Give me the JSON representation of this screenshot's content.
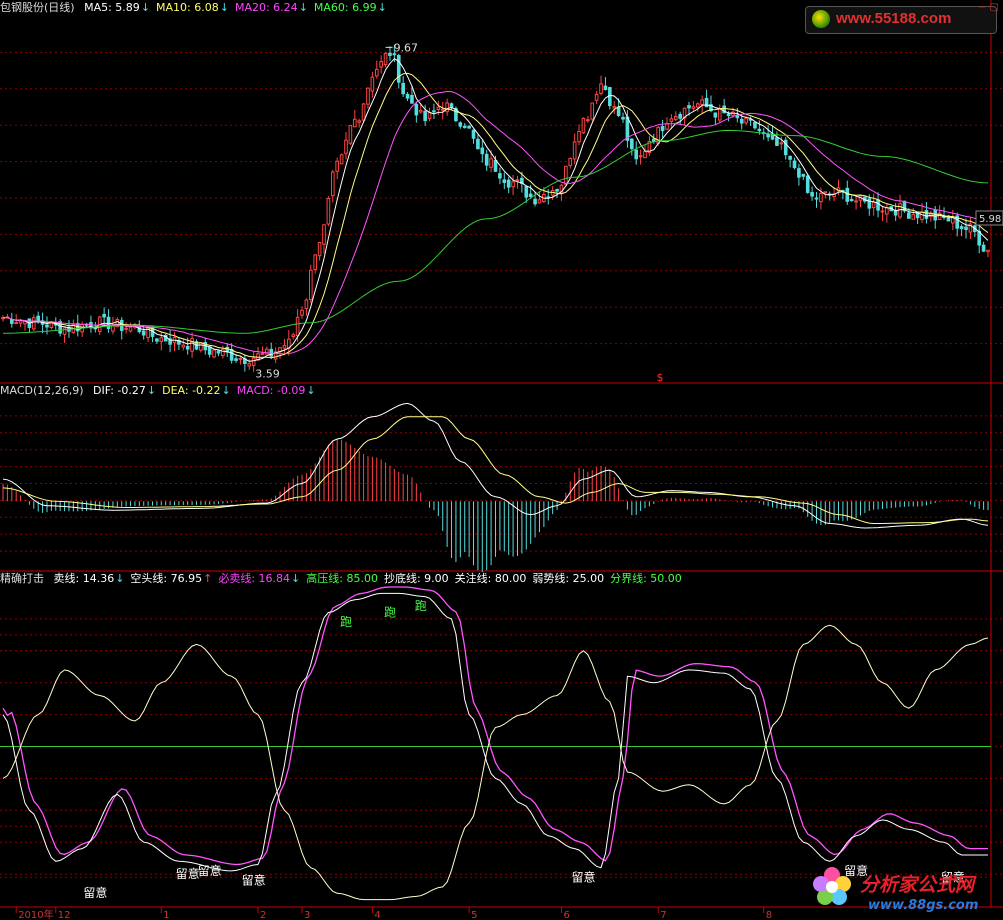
{
  "header_main": {
    "title": "包钢股份(日线)",
    "items": [
      {
        "label": "MA5: 5.89",
        "color": "#ffffff",
        "arrow": "↓"
      },
      {
        "label": "MA10: 6.08",
        "color": "#ffff66",
        "arrow": "↓"
      },
      {
        "label": "MA20: 6.24",
        "color": "#ff44ff",
        "arrow": "↓"
      },
      {
        "label": "MA60: 6.99",
        "color": "#44ff44",
        "arrow": "↓"
      }
    ]
  },
  "header_macd": {
    "title": "MACD(12,26,9)",
    "items": [
      {
        "label": "DIF: -0.27",
        "color": "#ffffff",
        "arrow": "↓"
      },
      {
        "label": "DEA: -0.22",
        "color": "#ffff66",
        "arrow": "↓"
      },
      {
        "label": "MACD: -0.09",
        "color": "#ff44ff",
        "arrow": "↓"
      }
    ]
  },
  "header_ind": {
    "title": "精确打击",
    "items": [
      {
        "label": "卖线: 14.36",
        "color": "#ffffff",
        "arrow": "↓"
      },
      {
        "label": "空头线: 76.95",
        "color": "#ffffff",
        "arrow": "↑"
      },
      {
        "label": "必卖线: 16.84",
        "color": "#ff44ff",
        "arrow": "↓"
      },
      {
        "label": "高压线: 85.00",
        "color": "#44ff44",
        "arrow": ""
      },
      {
        "label": "抄底线: 9.00",
        "color": "#ffffff",
        "arrow": ""
      },
      {
        "label": "关注线: 80.00",
        "color": "#ffffff",
        "arrow": ""
      },
      {
        "label": "弱势线: 25.00",
        "color": "#ffffff",
        "arrow": ""
      },
      {
        "label": "分界线: 50.00",
        "color": "#44ff44",
        "arrow": ""
      }
    ]
  },
  "watermark_top": "www.55188.com",
  "brand": {
    "name": "分析家公式网",
    "url": "www.88gs.com"
  },
  "colors": {
    "up": "#ff4444",
    "down": "#55dddd",
    "ma5": "#ffffff",
    "ma10": "#ffff88",
    "ma20": "#ff55ff",
    "ma60": "#33cc33",
    "grid": "#8a0000",
    "frame": "#cc0000"
  },
  "chart_data": [
    {
      "type": "candlestick",
      "price_annotations": {
        "high": "9.67",
        "low": "3.59",
        "last": "5.98"
      },
      "ylim": [
        3.2,
        10.2
      ],
      "anchors": [
        [
          0,
          4.4
        ],
        [
          8,
          4.3
        ],
        [
          14,
          4.2
        ],
        [
          22,
          4.3
        ],
        [
          30,
          4.2
        ],
        [
          36,
          4.0
        ],
        [
          42,
          3.9
        ],
        [
          48,
          3.75
        ],
        [
          55,
          3.62
        ],
        [
          60,
          3.68
        ],
        [
          65,
          3.9
        ],
        [
          68,
          4.6
        ],
        [
          72,
          5.9
        ],
        [
          76,
          7.3
        ],
        [
          80,
          8.2
        ],
        [
          85,
          9.2
        ],
        [
          88,
          9.5
        ],
        [
          92,
          8.6
        ],
        [
          96,
          8.2
        ],
        [
          100,
          8.5
        ],
        [
          104,
          8.2
        ],
        [
          110,
          7.4
        ],
        [
          116,
          7.0
        ],
        [
          121,
          6.7
        ],
        [
          126,
          6.9
        ],
        [
          132,
          8.2
        ],
        [
          136,
          8.9
        ],
        [
          140,
          8.3
        ],
        [
          144,
          7.4
        ],
        [
          148,
          7.9
        ],
        [
          152,
          8.3
        ],
        [
          158,
          8.5
        ],
        [
          164,
          8.3
        ],
        [
          170,
          8.1
        ],
        [
          176,
          7.7
        ],
        [
          180,
          7.3
        ],
        [
          184,
          6.7
        ],
        [
          190,
          6.8
        ],
        [
          196,
          6.6
        ],
        [
          202,
          6.5
        ],
        [
          208,
          6.4
        ],
        [
          214,
          6.3
        ],
        [
          220,
          6.1
        ],
        [
          224,
          5.7
        ]
      ],
      "ma60_anchors": [
        [
          0,
          4.1
        ],
        [
          30,
          4.25
        ],
        [
          55,
          4.1
        ],
        [
          70,
          4.3
        ],
        [
          90,
          5.1
        ],
        [
          110,
          6.3
        ],
        [
          130,
          7.1
        ],
        [
          150,
          7.8
        ],
        [
          165,
          8.0
        ],
        [
          180,
          7.9
        ],
        [
          200,
          7.5
        ],
        [
          224,
          6.99
        ]
      ]
    },
    {
      "type": "macd",
      "ylim": [
        -0.75,
        1.15
      ],
      "dif_anchors": [
        [
          0,
          0.25
        ],
        [
          10,
          -0.05
        ],
        [
          25,
          -0.1
        ],
        [
          45,
          -0.08
        ],
        [
          60,
          -0.02
        ],
        [
          68,
          0.2
        ],
        [
          76,
          0.7
        ],
        [
          84,
          0.95
        ],
        [
          92,
          1.1
        ],
        [
          98,
          0.9
        ],
        [
          104,
          0.45
        ],
        [
          112,
          0.05
        ],
        [
          120,
          -0.15
        ],
        [
          126,
          -0.05
        ],
        [
          132,
          0.25
        ],
        [
          138,
          0.35
        ],
        [
          144,
          0.05
        ],
        [
          152,
          0.12
        ],
        [
          160,
          0.1
        ],
        [
          170,
          0.05
        ],
        [
          180,
          -0.05
        ],
        [
          188,
          -0.25
        ],
        [
          196,
          -0.3
        ],
        [
          208,
          -0.27
        ],
        [
          218,
          -0.2
        ],
        [
          224,
          -0.27
        ]
      ],
      "dea_anchors": [
        [
          0,
          0.15
        ],
        [
          12,
          0.0
        ],
        [
          28,
          -0.07
        ],
        [
          45,
          -0.06
        ],
        [
          60,
          -0.03
        ],
        [
          68,
          0.05
        ],
        [
          76,
          0.35
        ],
        [
          84,
          0.7
        ],
        [
          92,
          0.95
        ],
        [
          100,
          0.95
        ],
        [
          106,
          0.7
        ],
        [
          114,
          0.3
        ],
        [
          122,
          0.05
        ],
        [
          128,
          -0.02
        ],
        [
          134,
          0.1
        ],
        [
          140,
          0.2
        ],
        [
          146,
          0.1
        ],
        [
          154,
          0.1
        ],
        [
          162,
          0.08
        ],
        [
          172,
          0.05
        ],
        [
          182,
          -0.02
        ],
        [
          190,
          -0.15
        ],
        [
          198,
          -0.25
        ],
        [
          210,
          -0.24
        ],
        [
          220,
          -0.2
        ],
        [
          224,
          -0.22
        ]
      ]
    },
    {
      "type": "line",
      "ylim": [
        0,
        100
      ],
      "reference_lines": {
        "高压线": 85,
        "关注线": 80,
        "分界线": 50,
        "弱势线": 25,
        "抄底线": 9
      },
      "sell_anchors": [
        [
          0,
          60
        ],
        [
          6,
          30
        ],
        [
          12,
          14
        ],
        [
          18,
          18
        ],
        [
          26,
          35
        ],
        [
          32,
          20
        ],
        [
          40,
          14
        ],
        [
          52,
          11
        ],
        [
          58,
          13
        ],
        [
          62,
          35
        ],
        [
          68,
          70
        ],
        [
          74,
          92
        ],
        [
          80,
          96
        ],
        [
          86,
          98
        ],
        [
          90,
          98
        ],
        [
          96,
          97
        ],
        [
          102,
          90
        ],
        [
          106,
          60
        ],
        [
          112,
          40
        ],
        [
          118,
          32
        ],
        [
          124,
          22
        ],
        [
          130,
          18
        ],
        [
          136,
          12
        ],
        [
          140,
          40
        ],
        [
          142,
          72
        ],
        [
          148,
          70
        ],
        [
          156,
          74
        ],
        [
          164,
          73
        ],
        [
          170,
          68
        ],
        [
          176,
          40
        ],
        [
          182,
          20
        ],
        [
          188,
          14
        ],
        [
          194,
          22
        ],
        [
          200,
          27
        ],
        [
          206,
          24
        ],
        [
          214,
          20
        ],
        [
          218,
          16
        ],
        [
          224,
          16
        ]
      ],
      "short_anchors": [
        [
          0,
          40
        ],
        [
          8,
          60
        ],
        [
          14,
          74
        ],
        [
          22,
          66
        ],
        [
          30,
          58
        ],
        [
          36,
          70
        ],
        [
          44,
          82
        ],
        [
          52,
          72
        ],
        [
          58,
          60
        ],
        [
          64,
          30
        ],
        [
          70,
          12
        ],
        [
          76,
          4
        ],
        [
          82,
          2
        ],
        [
          88,
          2
        ],
        [
          94,
          3
        ],
        [
          100,
          6
        ],
        [
          106,
          26
        ],
        [
          112,
          56
        ],
        [
          118,
          60
        ],
        [
          126,
          66
        ],
        [
          132,
          80
        ],
        [
          138,
          64
        ],
        [
          142,
          42
        ],
        [
          150,
          36
        ],
        [
          156,
          38
        ],
        [
          164,
          32
        ],
        [
          170,
          38
        ],
        [
          176,
          58
        ],
        [
          182,
          82
        ],
        [
          188,
          88
        ],
        [
          194,
          82
        ],
        [
          200,
          70
        ],
        [
          206,
          62
        ],
        [
          212,
          74
        ],
        [
          220,
          82
        ],
        [
          224,
          84
        ]
      ],
      "labels": [
        {
          "text": "留意",
          "x": 21,
          "v": 4
        },
        {
          "text": "留意",
          "x": 42,
          "v": 10
        },
        {
          "text": "留意",
          "x": 47,
          "v": 11
        },
        {
          "text": "留意",
          "x": 57,
          "v": 8
        },
        {
          "text": "留意",
          "x": 132,
          "v": 9
        },
        {
          "text": "留意",
          "x": 194,
          "v": 11
        },
        {
          "text": "留意",
          "x": 216,
          "v": 9
        }
      ],
      "run_labels": [
        {
          "text": "跑",
          "x": 78,
          "v": 89
        },
        {
          "text": "跑",
          "x": 88,
          "v": 92
        },
        {
          "text": "跑",
          "x": 95,
          "v": 94
        }
      ]
    }
  ],
  "x_axis": {
    "ticks": [
      {
        "label": "2010年",
        "x": 3
      },
      {
        "label": "12",
        "x": 12
      },
      {
        "label": "1",
        "x": 36
      },
      {
        "label": "2",
        "x": 58
      },
      {
        "label": "3",
        "x": 68
      },
      {
        "label": "4",
        "x": 84
      },
      {
        "label": "5",
        "x": 106
      },
      {
        "label": "6",
        "x": 127
      },
      {
        "label": "7",
        "x": 149
      },
      {
        "label": "8",
        "x": 173
      }
    ]
  },
  "marker": "$"
}
